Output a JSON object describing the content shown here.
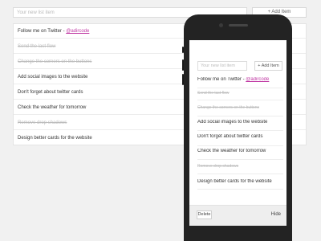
{
  "desktop": {
    "input_placeholder": "Your new list item",
    "add_label": "+ Add Item",
    "items": [
      {
        "text": "Follow me on Twitter - ",
        "handle": "@adircode",
        "done": false
      },
      {
        "text": "Send the last flow",
        "done": true
      },
      {
        "text": "Change the corners on the buttons",
        "done": true
      },
      {
        "text": "Add social images to the website",
        "done": false
      },
      {
        "text": "Don't forget about twitter cards",
        "done": false
      },
      {
        "text": "Check the weather for tomorrow",
        "done": false
      },
      {
        "text": "Remove drop shadows",
        "done": true
      },
      {
        "text": "Design better cards for the website",
        "done": false
      }
    ]
  },
  "phone": {
    "input_placeholder": "Your new list item",
    "add_label": "+ Add Item",
    "delete_label": "Delete",
    "hide_label": "Hide",
    "items": [
      {
        "text": "Follow me on Twitter - ",
        "handle": "@adircode",
        "done": false
      },
      {
        "text": "Send the last flow",
        "done": true
      },
      {
        "text": "Change the corners on the buttons",
        "done": true
      },
      {
        "text": "Add social images to the website",
        "done": false
      },
      {
        "text": "Don't forget about twitter cards",
        "done": false
      },
      {
        "text": "Check the weather for tomorrow",
        "done": false
      },
      {
        "text": "Remove drop shadows",
        "done": true
      },
      {
        "text": "Design better cards for the website",
        "done": false
      }
    ]
  },
  "colors": {
    "handle": "#c03aa4",
    "done": "#bdbdbd",
    "phone_body": "#232323"
  }
}
